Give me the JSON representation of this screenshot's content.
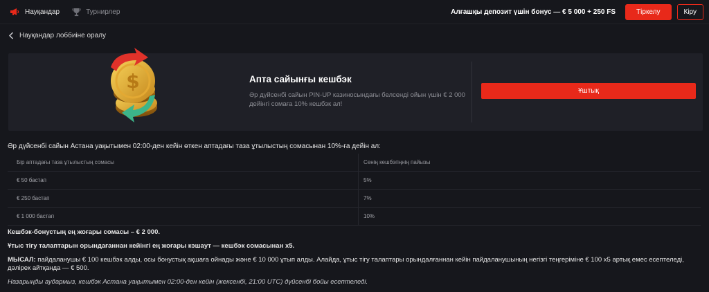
{
  "header": {
    "nav": [
      {
        "label": "Науқандар",
        "icon": "megaphone-icon",
        "active": true
      },
      {
        "label": "Турнирлер",
        "icon": "trophy-icon",
        "active": false
      }
    ],
    "bonus_text": "Алғашқы депозит үшін бонус — € 5 000 + 250 FS",
    "register_label": "Тіркелу",
    "login_label": "Кіру"
  },
  "back_label": "Науқандар лоббиіне оралу",
  "promo": {
    "title": "Апта сайынғы кешбэк",
    "description": "Әр дүйсенбі сайын PIN-UP казиносындағы белсенді ойын үшін € 2 000 дейінгі сомаға 10% кешбэк ал!",
    "button_label": "Ұштық"
  },
  "rules": {
    "intro": "Әр дүйсенбі сайын Астана уақытымен 02:00-ден кейін өткен аптадағы таза ұтылыстың сомасынан 10%-ға дейін ал:",
    "table": {
      "headers": [
        "Бір аптадағы таза ұтылыстың сомасы",
        "Сенің кешбэгіңнің пайызы"
      ],
      "rows": [
        [
          "€ 50 бастап",
          "5%"
        ],
        [
          "€ 250 бастап",
          "7%"
        ],
        [
          "€ 1 000 бастап",
          "10%"
        ]
      ]
    },
    "notes": {
      "max_cashback": "Кешбэк-бонустың ең жоғары сомасы – € 2 000.",
      "max_cashout": "Ұтыс тігу талаптарын орындағаннан кейінгі ең жоғары кэшаут — кешбэк сомасынан x5.",
      "example_label": "МЫСАЛ:",
      "example_text": " пайдаланушы € 100 кешбэк алды, осы бонустық ақшаға ойнады және € 10 000 ұтып алды. Алайда, ұтыс тігу талаптары орындалғаннан кейін пайдаланушының негізгі теңгеріміне € 100 x5 артық емес есептеледі, дәлірек айтқанда — € 500.",
      "footer": "Назарыңды аудармыз, кешбэк Астана уақытымен 02:00-ден кейін (жексенбі, 21:00 UTC) дүйсенбі бойы есептеледі."
    }
  },
  "colors": {
    "accent": "#e8291a",
    "background": "#16171c",
    "card": "#1f2027"
  }
}
